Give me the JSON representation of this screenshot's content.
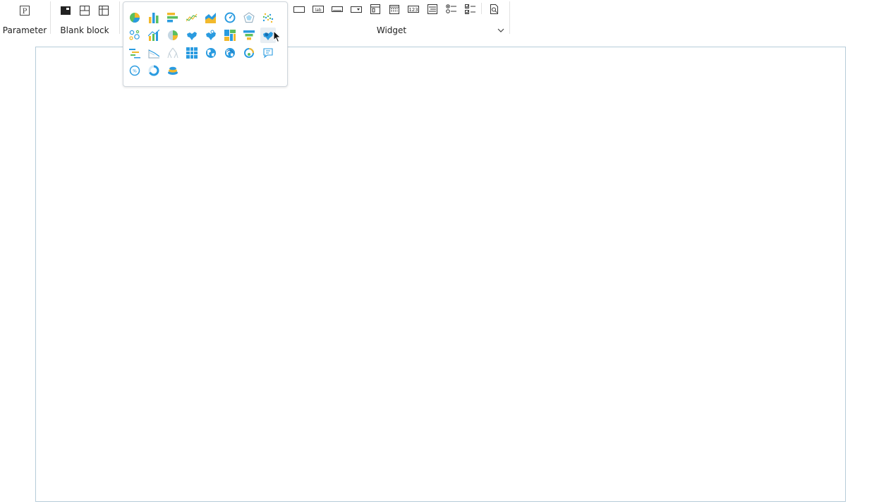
{
  "toolbar": {
    "parameter": {
      "label": "Parameter"
    },
    "blank_block": {
      "label": "Blank block"
    },
    "widget": {
      "label": "Widget"
    }
  },
  "widget_icons": [
    "rectangle-frame-icon",
    "label-widget-icon",
    "text-box-icon",
    "dropdown-icon",
    "form-block-icon",
    "date-picker-icon",
    "number-field-icon",
    "list-box-icon",
    "radio-group-icon",
    "checkbox-group-icon",
    "query-button-icon"
  ],
  "chart_types": [
    "pie-chart-icon",
    "column-chart-icon",
    "bar-chart-icon",
    "line-chart-icon",
    "area-chart-icon",
    "gauge-chart-icon",
    "radar-chart-icon",
    "scatter-chart-icon",
    "bubble-chart-icon",
    "combination-chart-icon",
    "rose-pie-chart-icon",
    "map-chart-icon",
    "point-map-icon",
    "treemap-chart-icon",
    "funnel-chart-icon",
    "heat-map-icon",
    "gantt-chart-icon",
    "box-plot-chart-icon",
    "tree-chart-icon",
    "table-chart-icon",
    "globe-chart-icon",
    "globe-flow-icon",
    "ring-chart-icon",
    "word-cloud-icon",
    "circle-progress-icon",
    "donut-progress-icon",
    "stacked-disk-icon"
  ],
  "colors": {
    "accent_blue": "#2a9be0",
    "accent_yellow": "#f2b92c",
    "accent_green": "#5bbf5e",
    "canvas_border": "#b6ccd9"
  }
}
